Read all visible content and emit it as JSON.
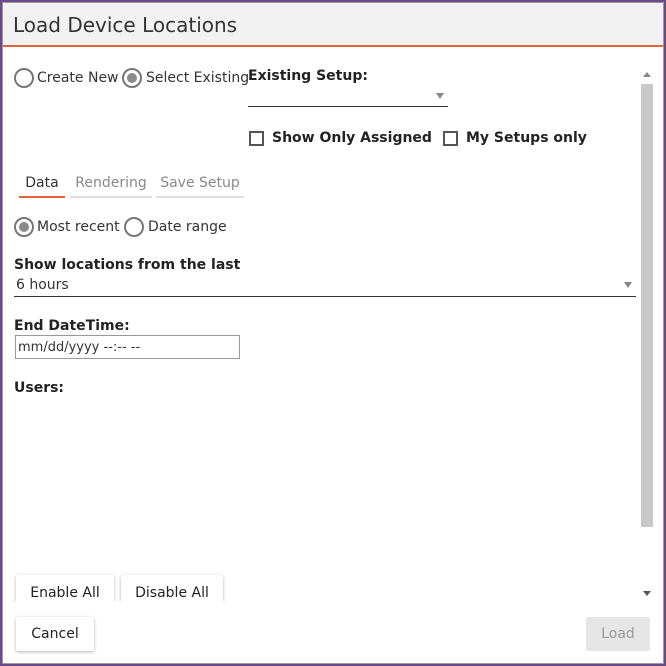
{
  "dialog": {
    "title": "Load Device Locations"
  },
  "setup_mode": {
    "create_new": "Create New",
    "select_existing": "Select Existing",
    "selected": "select_existing"
  },
  "existing_setup": {
    "label": "Existing Setup:",
    "value": ""
  },
  "filters": {
    "show_only_assigned": "Show Only Assigned",
    "my_setups_only": "My Setups only"
  },
  "tabs": [
    {
      "label": "Data",
      "active": true
    },
    {
      "label": "Rendering",
      "active": false
    },
    {
      "label": "Save Setup",
      "active": false
    }
  ],
  "time_mode": {
    "most_recent": "Most recent",
    "date_range": "Date range",
    "selected": "most_recent"
  },
  "show_locations": {
    "label": "Show locations from the last",
    "value": "6 hours"
  },
  "end_datetime": {
    "label": "End DateTime:",
    "placeholder": "mm/dd/yyyy --:-- --"
  },
  "users": {
    "label": "Users:"
  },
  "user_actions": {
    "enable_all": "Enable All",
    "disable_all": "Disable All"
  },
  "footer": {
    "cancel": "Cancel",
    "load": "Load"
  }
}
